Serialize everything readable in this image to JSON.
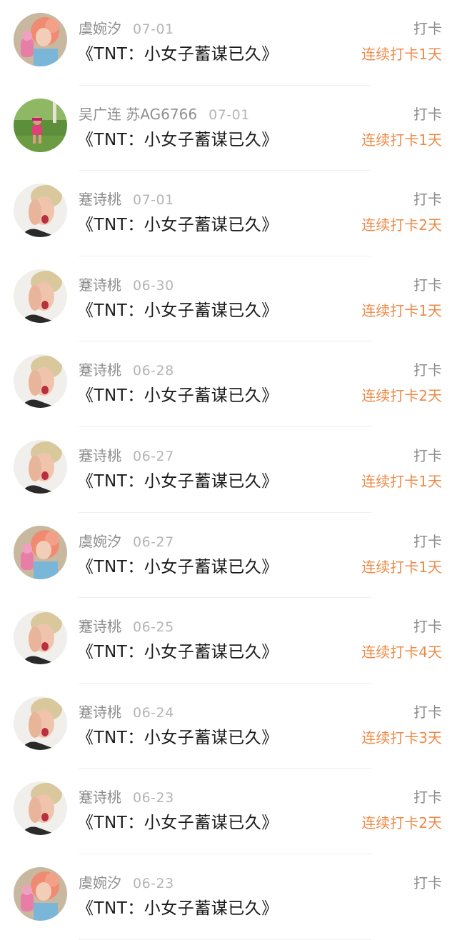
{
  "rows": [
    {
      "avatar": "avatar-pink-hair",
      "name": "虞婉汐",
      "date": "07-01",
      "title": "《TNT：小女子蓄谋已久》",
      "action": "打卡",
      "streak": "连续打卡1天"
    },
    {
      "avatar": "avatar-child-outdoor",
      "name": "吴广连 苏AG6766",
      "date": "07-01",
      "title": "《TNT：小女子蓄谋已久》",
      "action": "打卡",
      "streak": "连续打卡1天"
    },
    {
      "avatar": "avatar-blonde-portrait",
      "name": "蹇诗桃",
      "date": "07-01",
      "title": "《TNT：小女子蓄谋已久》",
      "action": "打卡",
      "streak": "连续打卡2天"
    },
    {
      "avatar": "avatar-blonde-portrait",
      "name": "蹇诗桃",
      "date": "06-30",
      "title": "《TNT：小女子蓄谋已久》",
      "action": "打卡",
      "streak": "连续打卡1天"
    },
    {
      "avatar": "avatar-blonde-portrait",
      "name": "蹇诗桃",
      "date": "06-28",
      "title": "《TNT：小女子蓄谋已久》",
      "action": "打卡",
      "streak": "连续打卡2天"
    },
    {
      "avatar": "avatar-blonde-portrait",
      "name": "蹇诗桃",
      "date": "06-27",
      "title": "《TNT：小女子蓄谋已久》",
      "action": "打卡",
      "streak": "连续打卡1天"
    },
    {
      "avatar": "avatar-pink-hair",
      "name": "虞婉汐",
      "date": "06-27",
      "title": "《TNT：小女子蓄谋已久》",
      "action": "打卡",
      "streak": "连续打卡1天"
    },
    {
      "avatar": "avatar-blonde-portrait",
      "name": "蹇诗桃",
      "date": "06-25",
      "title": "《TNT：小女子蓄谋已久》",
      "action": "打卡",
      "streak": "连续打卡4天"
    },
    {
      "avatar": "avatar-blonde-portrait",
      "name": "蹇诗桃",
      "date": "06-24",
      "title": "《TNT：小女子蓄谋已久》",
      "action": "打卡",
      "streak": "连续打卡3天"
    },
    {
      "avatar": "avatar-blonde-portrait",
      "name": "蹇诗桃",
      "date": "06-23",
      "title": "《TNT：小女子蓄谋已久》",
      "action": "打卡",
      "streak": "连续打卡2天"
    },
    {
      "avatar": "avatar-pink-hair",
      "name": "虞婉汐",
      "date": "06-23",
      "title": "《TNT：小女子蓄谋已久》",
      "action": "打卡",
      "streak": ""
    }
  ]
}
